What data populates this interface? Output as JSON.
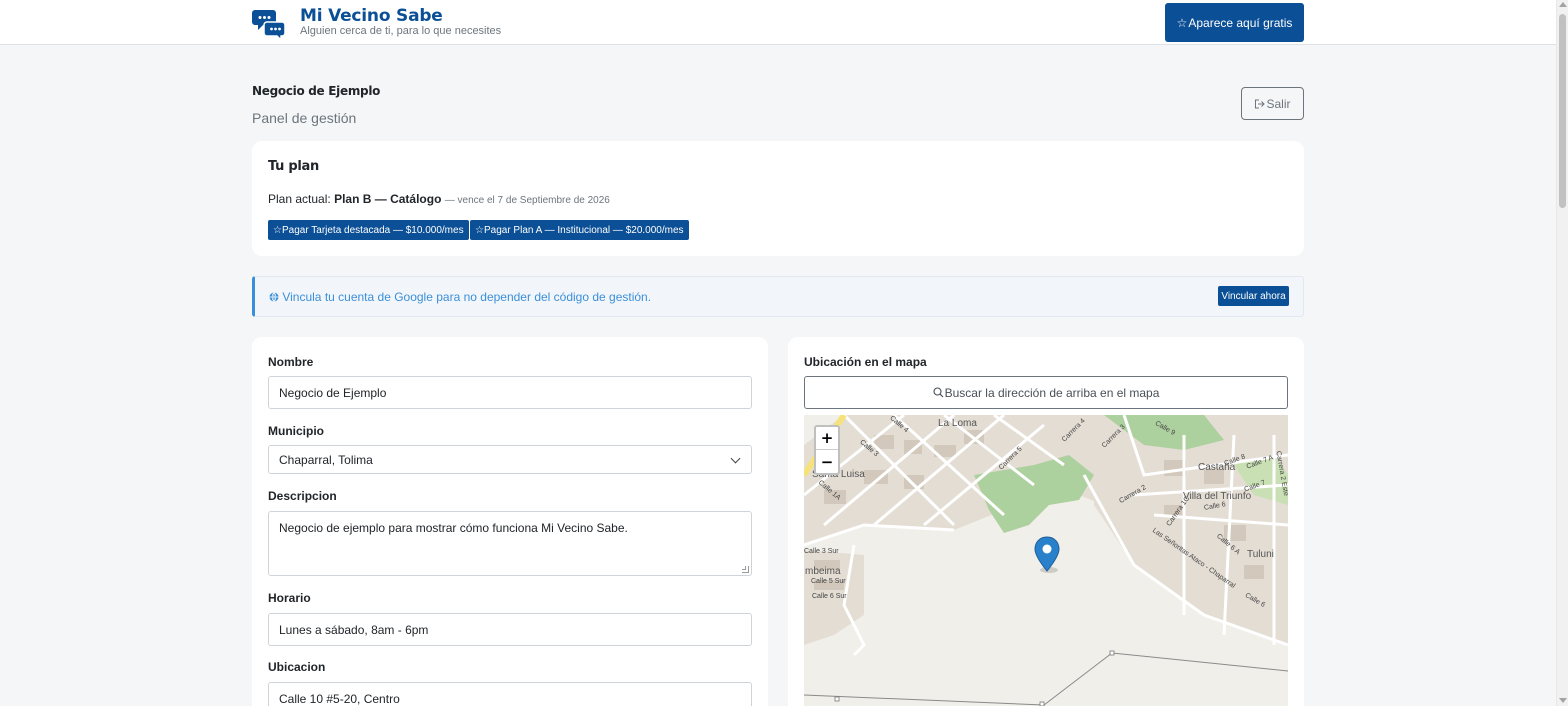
{
  "header": {
    "brand_title": "Mi Vecino Sabe",
    "brand_subtitle": "Alguien cerca de ti, para lo que necesites",
    "cta_label": "Aparece aquí gratis"
  },
  "page": {
    "business_name": "Negocio de Ejemplo",
    "panel_title": "Panel de gestión",
    "logout_label": "Salir"
  },
  "plan": {
    "heading": "Tu plan",
    "current_prefix": "Plan actual:",
    "current_plan": "Plan B — Catálogo",
    "expiry": "— vence el 7 de Septiembre de 2026",
    "pay_featured": "Pagar Tarjeta destacada — $10.000/mes",
    "pay_plan_a": "Pagar Plan A — Institucional — $20.000/mes"
  },
  "alert": {
    "text": "Vincula tu cuenta de Google para no depender del código de gestión.",
    "button": "Vincular ahora"
  },
  "form": {
    "name_label": "Nombre",
    "name_value": "Negocio de Ejemplo",
    "municipality_label": "Municipio",
    "municipality_value": "Chaparral, Tolima",
    "description_label": "Descripcion",
    "description_value": "Negocio de ejemplo para mostrar cómo funciona Mi Vecino Sabe.",
    "schedule_label": "Horario",
    "schedule_value": "Lunes a sábado, 8am - 6pm",
    "location_label": "Ubicacion",
    "location_value": "Calle 10 #5-20, Centro"
  },
  "map": {
    "label": "Ubicación en el mapa",
    "search_button": "Buscar la dirección de arriba en el mapa",
    "zoom_in": "+",
    "zoom_out": "−",
    "places": {
      "la_loma": "La Loma",
      "castana": "Castaña",
      "villa_triunfo": "Villa del Triunfo",
      "santa_luisa": "Santa Luisa",
      "tuluni": "Tuluni",
      "combeima": "mbeima"
    },
    "streets": {
      "calle_3_sur": "Calle 3 Sur",
      "calle_5_sur": "Calle 5 Sur",
      "calle_6_sur": "Calle 6 Sur",
      "calle_1a": "Calle 1A",
      "calle_3": "Calle 3",
      "calle_4": "Calle 4",
      "carrera_3": "Carrera 3",
      "carrera_4": "Carrera 4",
      "carrera_5": "Carrera 5",
      "calle_9": "Calle 9",
      "calle_8": "Calle 8",
      "calle_7a": "Calle 7 A",
      "calle_7": "Calle 7",
      "calle_6": "Calle 6",
      "carrera_2": "Carrera 2",
      "carrera_1c": "Carrera 1C",
      "carrera_2_este": "Carrera 2 Este",
      "calle_6a": "Calle 6 A",
      "via": "Las Señoritas Ataco - Chaparral",
      "calle_6b": "Calle 6"
    }
  },
  "colors": {
    "brand": "#0b4f96",
    "alert_text": "#3b8fd9",
    "muted": "#6c757d"
  },
  "icons": {
    "brand": "chat-bubbles-icon",
    "cta": "star-icon",
    "logout": "logout-icon",
    "google": "globe-icon",
    "search": "search-icon",
    "marker": "map-pin-icon"
  }
}
